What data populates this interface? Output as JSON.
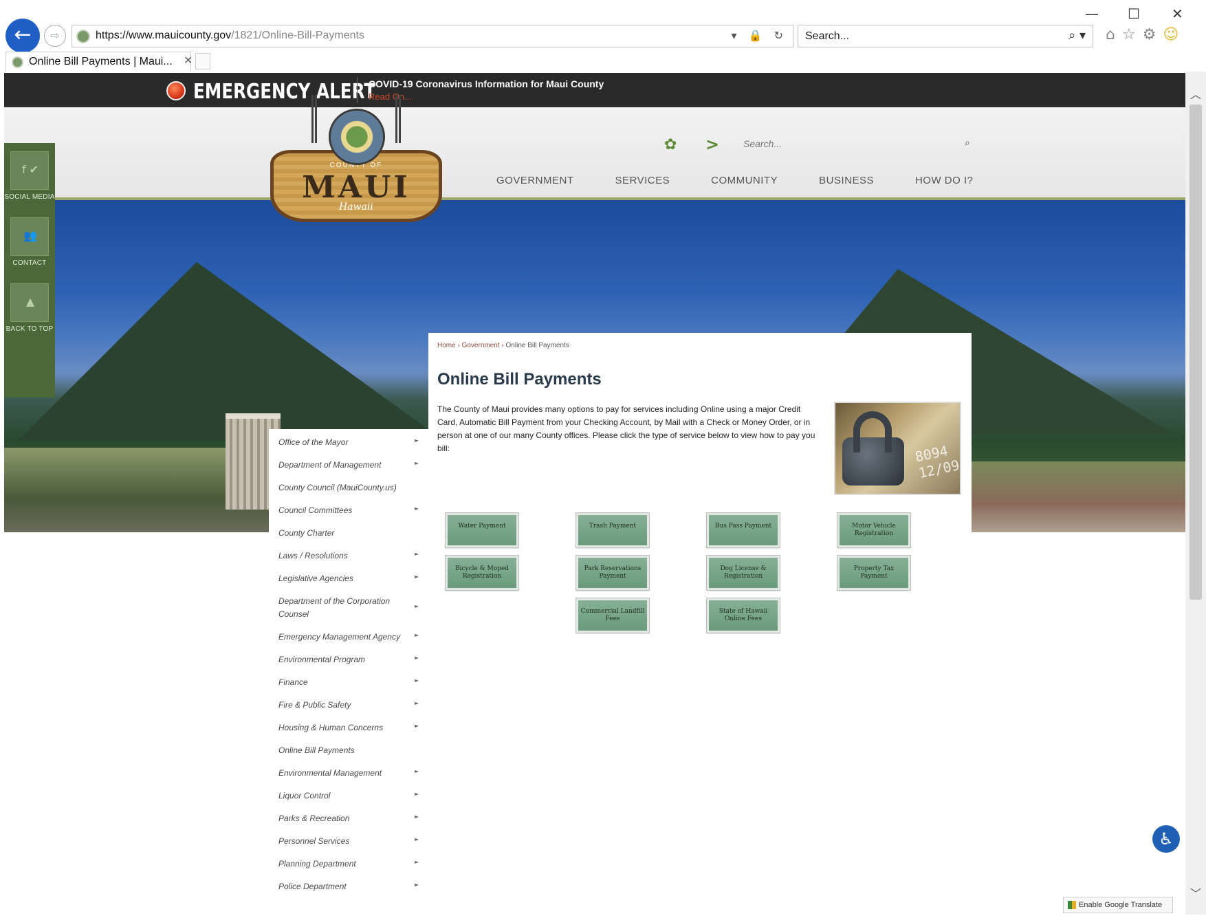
{
  "browser": {
    "window_controls": {
      "minimize": "—",
      "maximize": "☐",
      "close": "✕"
    },
    "url_host": "https://www.mauicounty.gov",
    "url_path": "/1821/Online-Bill-Payments",
    "search_placeholder": "Search...",
    "tab_title": "Online Bill Payments | Maui...",
    "back_icon": "←",
    "forward_icon": "⇨",
    "address_icons": "▾ 🔒 ↻",
    "search_icon": "⌕ ▾",
    "toolbar_icons": [
      "⌂",
      "☆",
      "⚙",
      "☺"
    ]
  },
  "alert": {
    "title": "EMERGENCY ALERT",
    "message": "COVID-19 Coronavirus Information for Maui County",
    "link": "Read On..."
  },
  "header": {
    "logo": {
      "county_of": "COUNTY OF",
      "name": "MAUI",
      "state": "Hawaii"
    },
    "search_placeholder": "Search...",
    "nav": [
      "GOVERNMENT",
      "SERVICES",
      "COMMUNITY",
      "BUSINESS",
      "HOW DO I?"
    ]
  },
  "social_bar": {
    "items": [
      {
        "label": "SOCIAL MEDIA",
        "glyph": "f ✔"
      },
      {
        "label": "CONTACT",
        "glyph": "👥"
      },
      {
        "label": "BACK TO TOP",
        "glyph": "▲"
      }
    ]
  },
  "breadcrumb": {
    "home": "Home",
    "sep": "›",
    "section": "Government",
    "current": "Online Bill Payments"
  },
  "main": {
    "title": "Online Bill Payments",
    "intro": "The County of Maui provides many options to pay for services including Online using a major Credit Card, Automatic Bill Payment from your Checking Account, by Mail with a Check or Money Order, or in person at one of our many County offices. Please click the type of service below to view how to pay you bill:",
    "photo_digits": "8094 12/09",
    "payment_buttons": [
      "Water Payment",
      "Trash Payment",
      "Bus Pass Payment",
      "Motor Vehicle Registration",
      "Bicycle & Moped Registration",
      "Park Reservations Payment",
      "Dog License & Registration",
      "Property Tax Payment",
      "Commercial Landfill Fees",
      "State of Hawaii Online Fees"
    ]
  },
  "side_nav": {
    "arrow": "►",
    "items": [
      {
        "label": "Office of the Mayor",
        "arrow": true
      },
      {
        "label": "Department of Management",
        "arrow": true
      },
      {
        "label": "County Council (MauiCounty.us)",
        "arrow": false
      },
      {
        "label": "Council Committees",
        "arrow": true
      },
      {
        "label": "County Charter",
        "arrow": false
      },
      {
        "label": "Laws / Resolutions",
        "arrow": true
      },
      {
        "label": "Legislative Agencies",
        "arrow": true
      },
      {
        "label": "Department of the Corporation Counsel",
        "arrow": true
      },
      {
        "label": "Emergency Management Agency",
        "arrow": true
      },
      {
        "label": "Environmental Program",
        "arrow": true
      },
      {
        "label": "Finance",
        "arrow": true
      },
      {
        "label": "Fire & Public Safety",
        "arrow": true
      },
      {
        "label": "Housing & Human Concerns",
        "arrow": true
      },
      {
        "label": "Online Bill Payments",
        "arrow": false
      },
      {
        "label": "Environmental Management",
        "arrow": true
      },
      {
        "label": "Liquor Control",
        "arrow": true
      },
      {
        "label": "Parks & Recreation",
        "arrow": true
      },
      {
        "label": "Personnel Services",
        "arrow": true
      },
      {
        "label": "Planning Department",
        "arrow": true
      },
      {
        "label": "Police Department",
        "arrow": true
      }
    ]
  },
  "footer_widgets": {
    "accessibility_glyph": "♿",
    "translate_label": "Enable Google Translate"
  },
  "scrollbar": {
    "up": "︿",
    "down": "﹀"
  }
}
